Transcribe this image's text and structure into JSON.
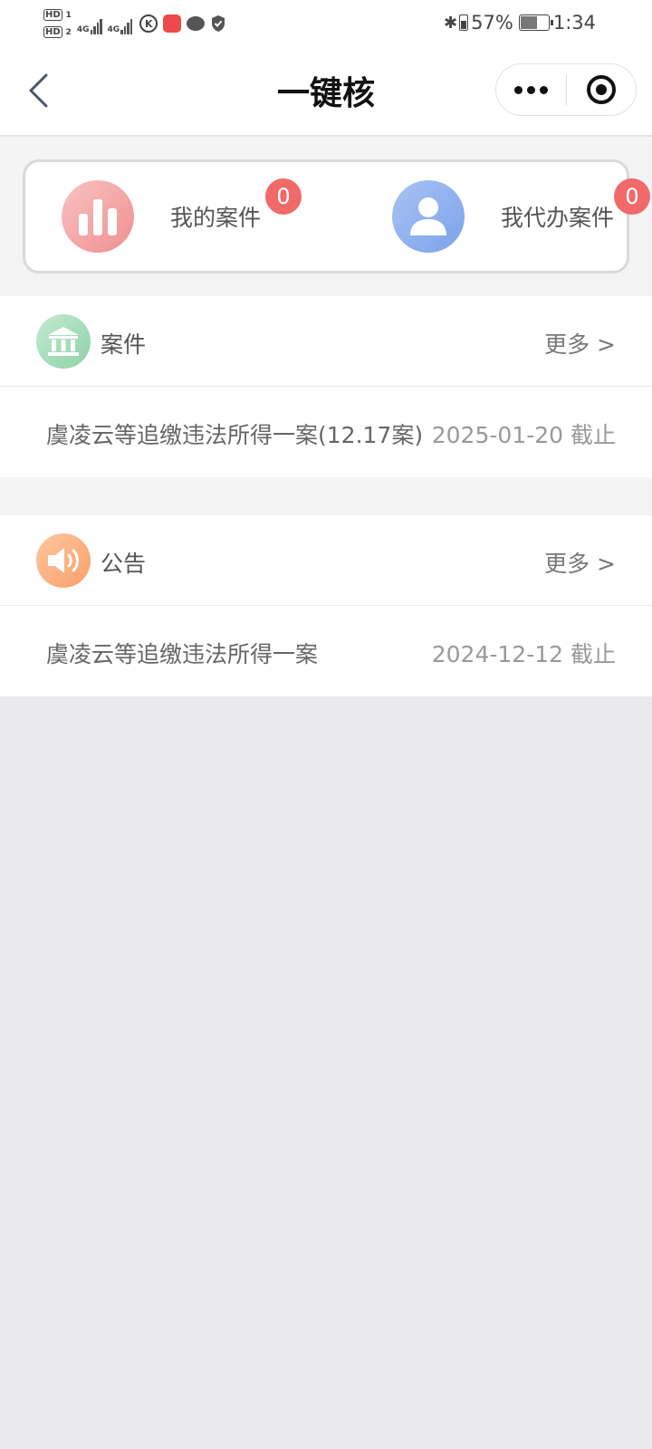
{
  "status_bar": {
    "sim1_label": "HD",
    "sim1_index": "1",
    "sim2_label": "HD",
    "sim2_index": "2",
    "net1": "4G",
    "net2": "4G",
    "app_k": "K",
    "battery_percent": "57%",
    "time": "1:34"
  },
  "nav": {
    "title": "一键核",
    "back_icon": "chevron-left-icon",
    "more_icon": "ellipsis-icon",
    "close_icon": "target-circle-icon"
  },
  "quick_actions": [
    {
      "label": "我的案件",
      "badge": "0",
      "icon": "bar-chart-icon",
      "color": "#ef8f8f"
    },
    {
      "label": "我代办案件",
      "badge": "0",
      "icon": "user-icon",
      "color": "#7ea2ea"
    }
  ],
  "cases": {
    "title": "案件",
    "more": "更多 >",
    "icon": "bank-icon",
    "items": [
      {
        "title": "虞凌云等追缴违法所得一案(12.17案)",
        "date": "2025-01-20 截止"
      }
    ]
  },
  "notices": {
    "title": "公告",
    "more": "更多 >",
    "icon": "speaker-icon",
    "items": [
      {
        "title": "虞凌云等追缴违法所得一案",
        "date": "2024-12-12 截止"
      }
    ]
  },
  "colors": {
    "accent_red": "#f06a6a",
    "page_bg": "#e9e9ee"
  }
}
